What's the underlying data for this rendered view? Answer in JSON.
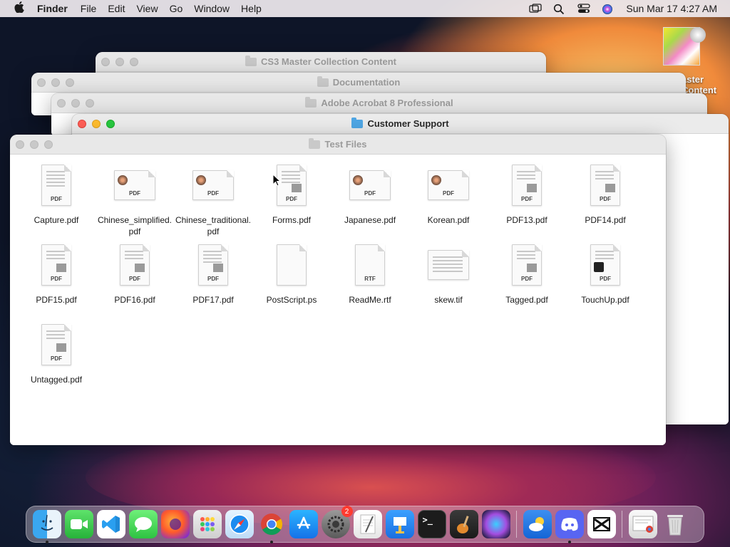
{
  "menubar": {
    "app_name": "Finder",
    "menus": [
      "File",
      "Edit",
      "View",
      "Go",
      "Window",
      "Help"
    ],
    "clock": "Sun Mar 17  4:27 AM"
  },
  "desktop_icon": {
    "label_line1": "aster",
    "label_line2": "Content"
  },
  "windows": {
    "w1": {
      "title": "CS3 Master Collection Content"
    },
    "w2": {
      "title": "Documentation"
    },
    "w3": {
      "title": "Adobe Acrobat 8 Professional"
    },
    "w4": {
      "title": "Customer Support"
    },
    "w5": {
      "title": "Test Files"
    }
  },
  "files": [
    {
      "name": "Capture.pdf",
      "tag": "PDF"
    },
    {
      "name": "Chinese_simplified.pdf",
      "tag": "PDF"
    },
    {
      "name": "Chinese_traditional.pdf",
      "tag": "PDF"
    },
    {
      "name": "Forms.pdf",
      "tag": "PDF"
    },
    {
      "name": "Japanese.pdf",
      "tag": "PDF"
    },
    {
      "name": "Korean.pdf",
      "tag": "PDF"
    },
    {
      "name": "PDF13.pdf",
      "tag": "PDF"
    },
    {
      "name": "PDF14.pdf",
      "tag": "PDF"
    },
    {
      "name": "PDF15.pdf",
      "tag": "PDF"
    },
    {
      "name": "PDF16.pdf",
      "tag": "PDF"
    },
    {
      "name": "PDF17.pdf",
      "tag": "PDF"
    },
    {
      "name": "PostScript.ps",
      "tag": ""
    },
    {
      "name": "ReadMe.rtf",
      "tag": "RTF"
    },
    {
      "name": "skew.tif",
      "tag": ""
    },
    {
      "name": "Tagged.pdf",
      "tag": "PDF"
    },
    {
      "name": "TouchUp.pdf",
      "tag": "PDF"
    },
    {
      "name": "Untagged.pdf",
      "tag": "PDF"
    }
  ],
  "dock": {
    "settings_badge": "2",
    "terminal_prompt": ">_"
  },
  "colors": {
    "close": "#ff5f57",
    "minimize": "#febc2e",
    "maximize": "#28c840",
    "folder_active": "#4fa6e4"
  }
}
